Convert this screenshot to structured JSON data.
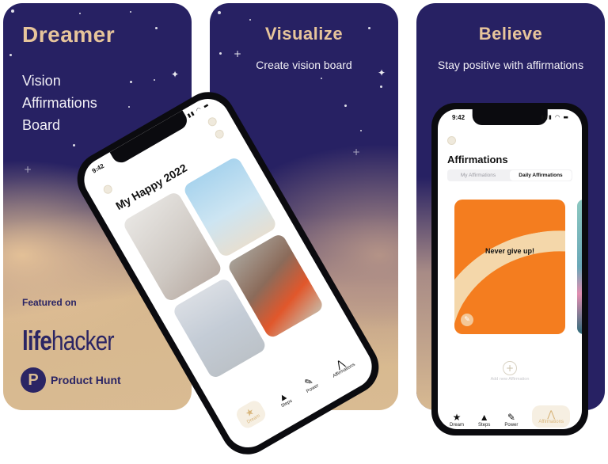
{
  "panels": [
    {
      "title": "Dreamer",
      "features": [
        "Vision",
        "Affirmations",
        "Board"
      ],
      "featured_label": "Featured on",
      "press": {
        "lifehacker_a": "life",
        "lifehacker_b": "hacker",
        "producthunt_logo": "P",
        "producthunt": "Product Hunt"
      }
    },
    {
      "title": "Visualize",
      "subtitle": "Create vision board",
      "phone": {
        "time": "9:42",
        "status_icons": "signal-wifi-battery",
        "board_title": "My Happy 2022",
        "tabs": [
          {
            "label": "Dream",
            "icon": "★",
            "active": true
          },
          {
            "label": "Steps",
            "icon": "▲"
          },
          {
            "label": "Power",
            "icon": "✎"
          },
          {
            "label": "Affirmations",
            "icon": "⋀"
          }
        ]
      }
    },
    {
      "title": "Believe",
      "subtitle": "Stay positive with affirmations",
      "phone": {
        "time": "9:42",
        "status_icons": "▮▮▮ ◠ ▬",
        "screen_title": "Affirmations",
        "segments": [
          "My Affirmations",
          "Daily Affirmations"
        ],
        "active_segment": "Daily Affirmations",
        "card_quote": "Never give up!",
        "add_label": "Add new Affirmation",
        "add_icon": "+",
        "edit_icon": "✎",
        "tabs": [
          {
            "label": "Dream",
            "icon": "★"
          },
          {
            "label": "Steps",
            "icon": "▲"
          },
          {
            "label": "Power",
            "icon": "✎"
          },
          {
            "label": "Affirmations",
            "icon": "⋀",
            "active": true
          }
        ]
      }
    }
  ],
  "colors": {
    "navy": "#272163",
    "sand": "#d9bb92",
    "gold_title": "#e7c59b",
    "orange": "#f47d1f"
  }
}
